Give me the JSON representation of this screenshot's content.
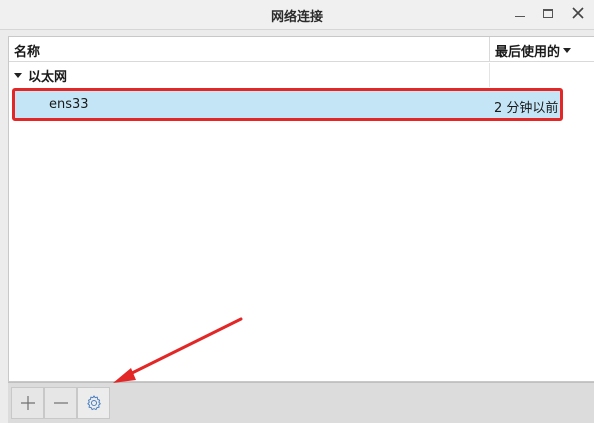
{
  "window": {
    "title": "网络连接"
  },
  "table": {
    "columns": {
      "name": "名称",
      "last_used": "最后使用的"
    },
    "groups": [
      {
        "label": "以太网",
        "connections": [
          {
            "name": "ens33",
            "last_used": "2 分钟以前"
          }
        ]
      }
    ]
  },
  "toolbar": {
    "add_icon": "plus-icon",
    "remove_icon": "minus-icon",
    "settings_icon": "gear-icon"
  },
  "colors": {
    "selection": "#c4e5f6",
    "highlight": "#e32626",
    "gear": "#4a7fc1"
  }
}
